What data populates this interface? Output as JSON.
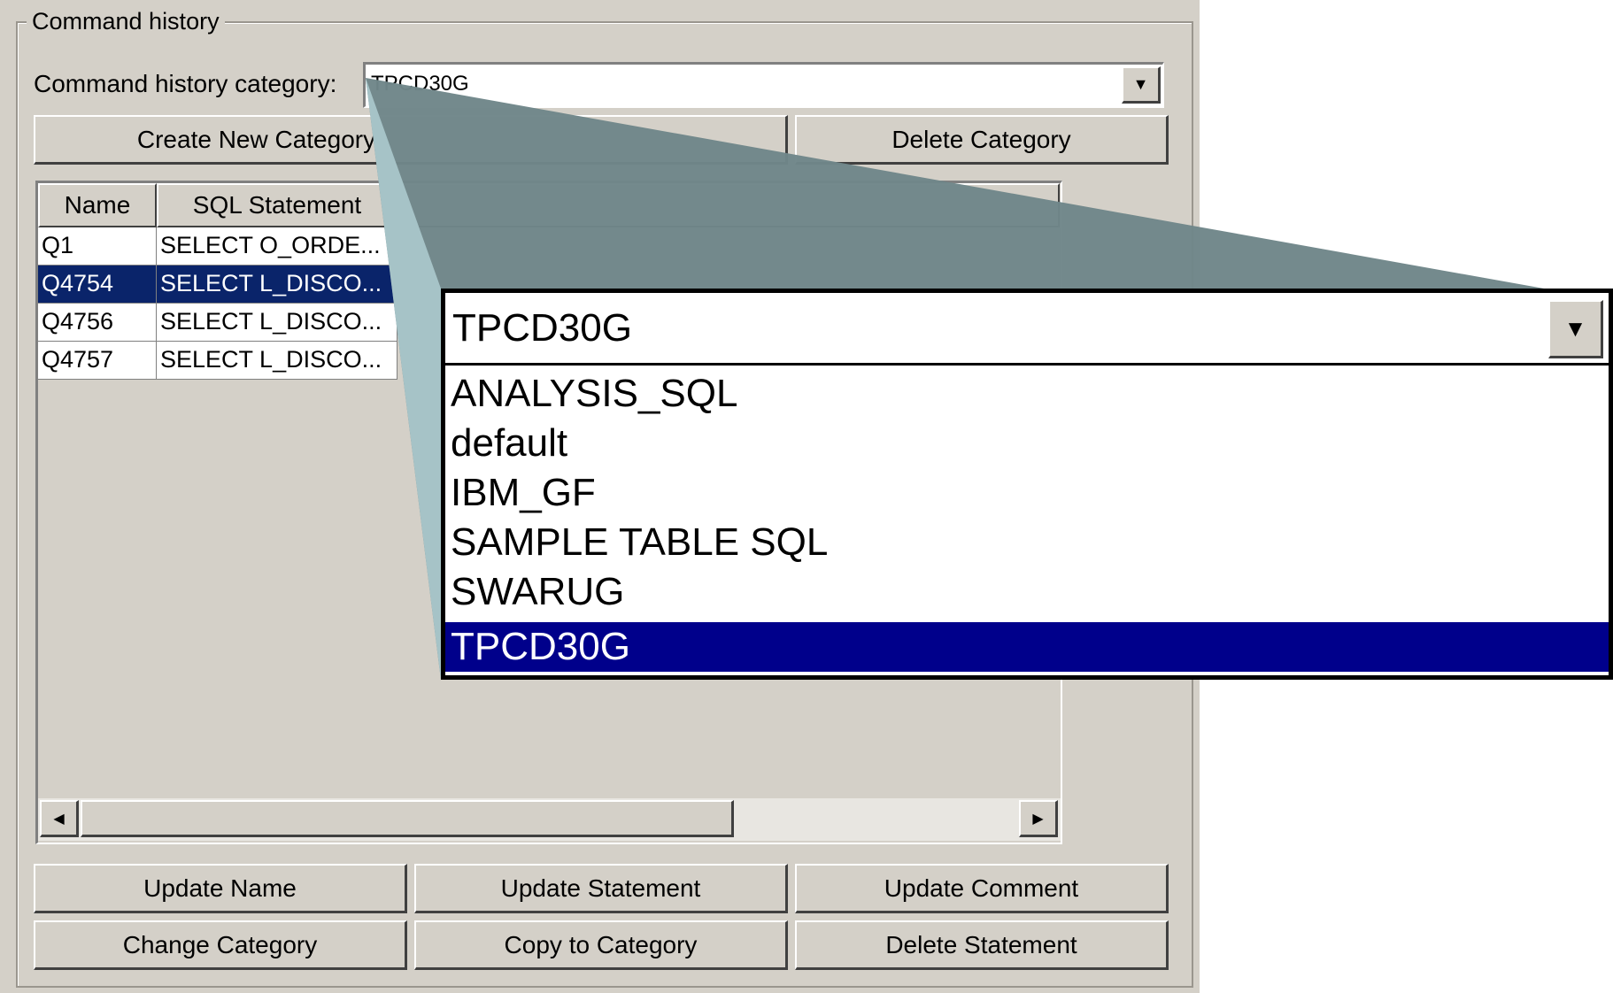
{
  "group_title": "Command history",
  "category_label": "Command history category:",
  "category_value": "TPCD30G",
  "buttons_top": {
    "create": "Create New Category",
    "delete": "Delete Category"
  },
  "table": {
    "columns": [
      "Name",
      "SQL Statement"
    ],
    "rows": [
      {
        "name": "Q1",
        "sql": "SELECT O_ORDE...",
        "selected": false
      },
      {
        "name": "Q4754",
        "sql": "SELECT L_DISCO...",
        "selected": true
      },
      {
        "name": "Q4756",
        "sql": "SELECT L_DISCO...",
        "selected": false
      },
      {
        "name": "Q4757",
        "sql": "SELECT L_DISCO...",
        "selected": false
      }
    ]
  },
  "buttons_bottom": {
    "update_name": "Update Name",
    "update_statement": "Update Statement",
    "update_comment": "Update Comment",
    "change_category": "Change Category",
    "copy_to_category": "Copy to Category",
    "delete_statement": "Delete Statement"
  },
  "dropdown": {
    "selected": "TPCD30G",
    "options": [
      "ANALYSIS_SQL",
      "default",
      "IBM_GF",
      "SAMPLE TABLE SQL",
      "SWARUG",
      "TPCD30G"
    ]
  },
  "colors": {
    "panel": "#d4d0c8",
    "selection": "#0a246a",
    "dropdown_selection": "#00008b",
    "callout": "#6f8689"
  }
}
